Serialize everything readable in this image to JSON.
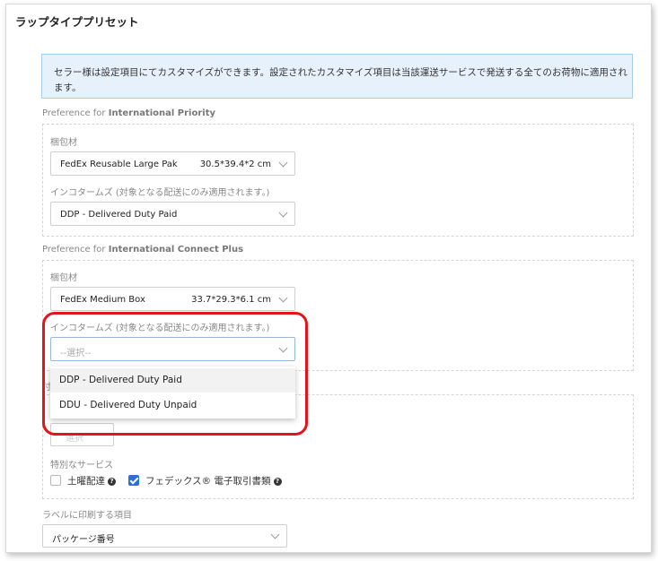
{
  "title": "ラップタイププリセット",
  "notice": "セラー様は設定項目にてカスタマイズができます。設定されたカスタマイズ項目は当該運送サービスで発送する全てのお荷物に適用されます。",
  "international_priority": {
    "label_prefix": "Preference for",
    "label_service": "International Priority",
    "packaging_label": "梱包材",
    "packaging_value": "FedEx Reusable Large Pak",
    "packaging_dims": "30.5*39.4*2 cm",
    "incoterms_label": "インコタームズ (対象となる配送にのみ適用されます。)",
    "incoterms_value": "DDP - Delivered Duty Paid"
  },
  "international_connect_plus": {
    "label_prefix": "Preference for",
    "label_service": "International Connect Plus",
    "packaging_label": "梱包材",
    "packaging_value": "FedEx Medium Box",
    "packaging_dims": "33.7*29.3*6.1 cm",
    "incoterms_label": "インコタームズ (対象となる配送にのみ適用されます。)",
    "incoterms_placeholder": "--選択--"
  },
  "incoterms_dropdown": {
    "options": [
      "DDP - Delivered Duty Paid",
      "DDU - Delivered Duty Unpaid"
    ]
  },
  "partial": {
    "section_char": "付",
    "select_text": "選択"
  },
  "special_services": {
    "label": "特別なサービス",
    "saturday_label": "土曜配達",
    "saturday_checked": false,
    "etd_label": "フェデックス® 電子取引書類",
    "etd_checked": true,
    "help_glyph": "?"
  },
  "label_print": {
    "label": "ラベルに印刷する項目",
    "value": "パッケージ番号"
  },
  "colors": {
    "highlight_ring": "#e3141a",
    "notice_bg": "#e6f1fb",
    "checkbox_on": "#2e6fd6"
  }
}
